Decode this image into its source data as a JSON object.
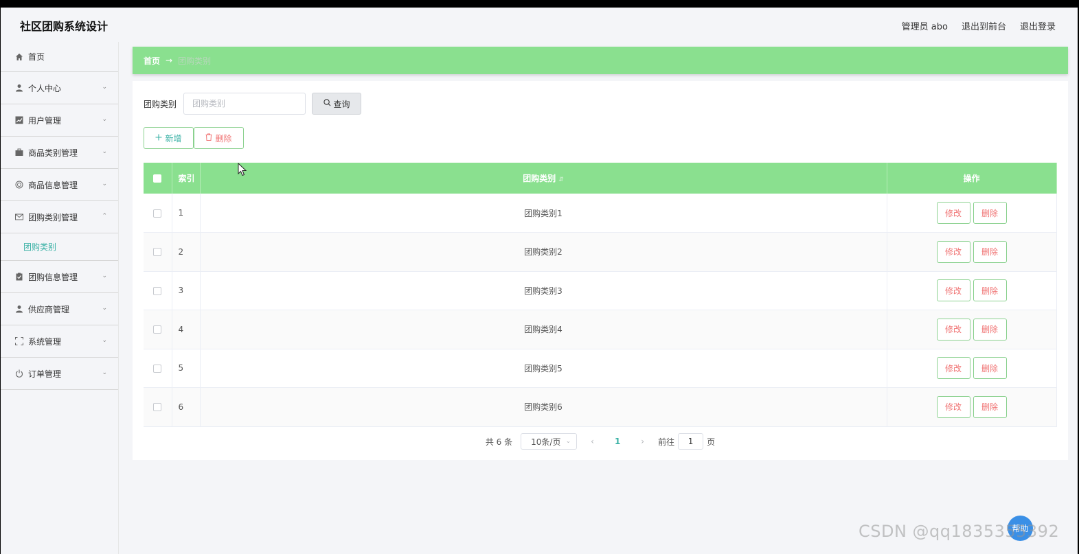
{
  "app": {
    "title": "社区团购系统设计"
  },
  "header": {
    "admin_label": "管理员 abo",
    "back_front": "退出到前台",
    "logout": "退出登录"
  },
  "sidebar": {
    "items": [
      {
        "label": "首页",
        "icon": "home-icon"
      },
      {
        "label": "个人中心",
        "icon": "user-icon"
      },
      {
        "label": "用户管理",
        "icon": "chart-icon"
      },
      {
        "label": "商品类别管理",
        "icon": "briefcase-icon"
      },
      {
        "label": "商品信息管理",
        "icon": "lifebuoy-icon"
      },
      {
        "label": "团购类别管理",
        "icon": "mail-icon",
        "expanded": true
      },
      {
        "label": "团购信息管理",
        "icon": "clipboard-icon"
      },
      {
        "label": "供应商管理",
        "icon": "user-icon"
      },
      {
        "label": "系统管理",
        "icon": "fullscreen-icon"
      },
      {
        "label": "订单管理",
        "icon": "power-icon"
      }
    ],
    "subitem": "团购类别"
  },
  "breadcrumb": {
    "home": "首页",
    "separator": "→",
    "current": "团购类别"
  },
  "search": {
    "label": "团购类别",
    "placeholder": "团购类别",
    "value": "",
    "query_button": "查询"
  },
  "actions": {
    "add": "新增",
    "delete": "删除"
  },
  "table": {
    "columns": [
      "索引",
      "团购类别",
      "操作"
    ],
    "rows": [
      {
        "index": "1",
        "name": "团购类别1"
      },
      {
        "index": "2",
        "name": "团购类别2"
      },
      {
        "index": "3",
        "name": "团购类别3"
      },
      {
        "index": "4",
        "name": "团购类别4"
      },
      {
        "index": "5",
        "name": "团购类别5"
      },
      {
        "index": "6",
        "name": "团购类别6"
      }
    ],
    "edit_label": "修改",
    "delete_label": "删除"
  },
  "pagination": {
    "total": "共 6 条",
    "page_size": "10条/页",
    "current_page": "1",
    "goto_label": "前往",
    "goto_value": "1",
    "page_suffix": "页"
  },
  "float_button": "帮助",
  "watermark": "CSDN @qq1835355392",
  "colors": {
    "accent": "#8ae08f",
    "teal": "#39b1a5",
    "danger": "#f07474"
  }
}
